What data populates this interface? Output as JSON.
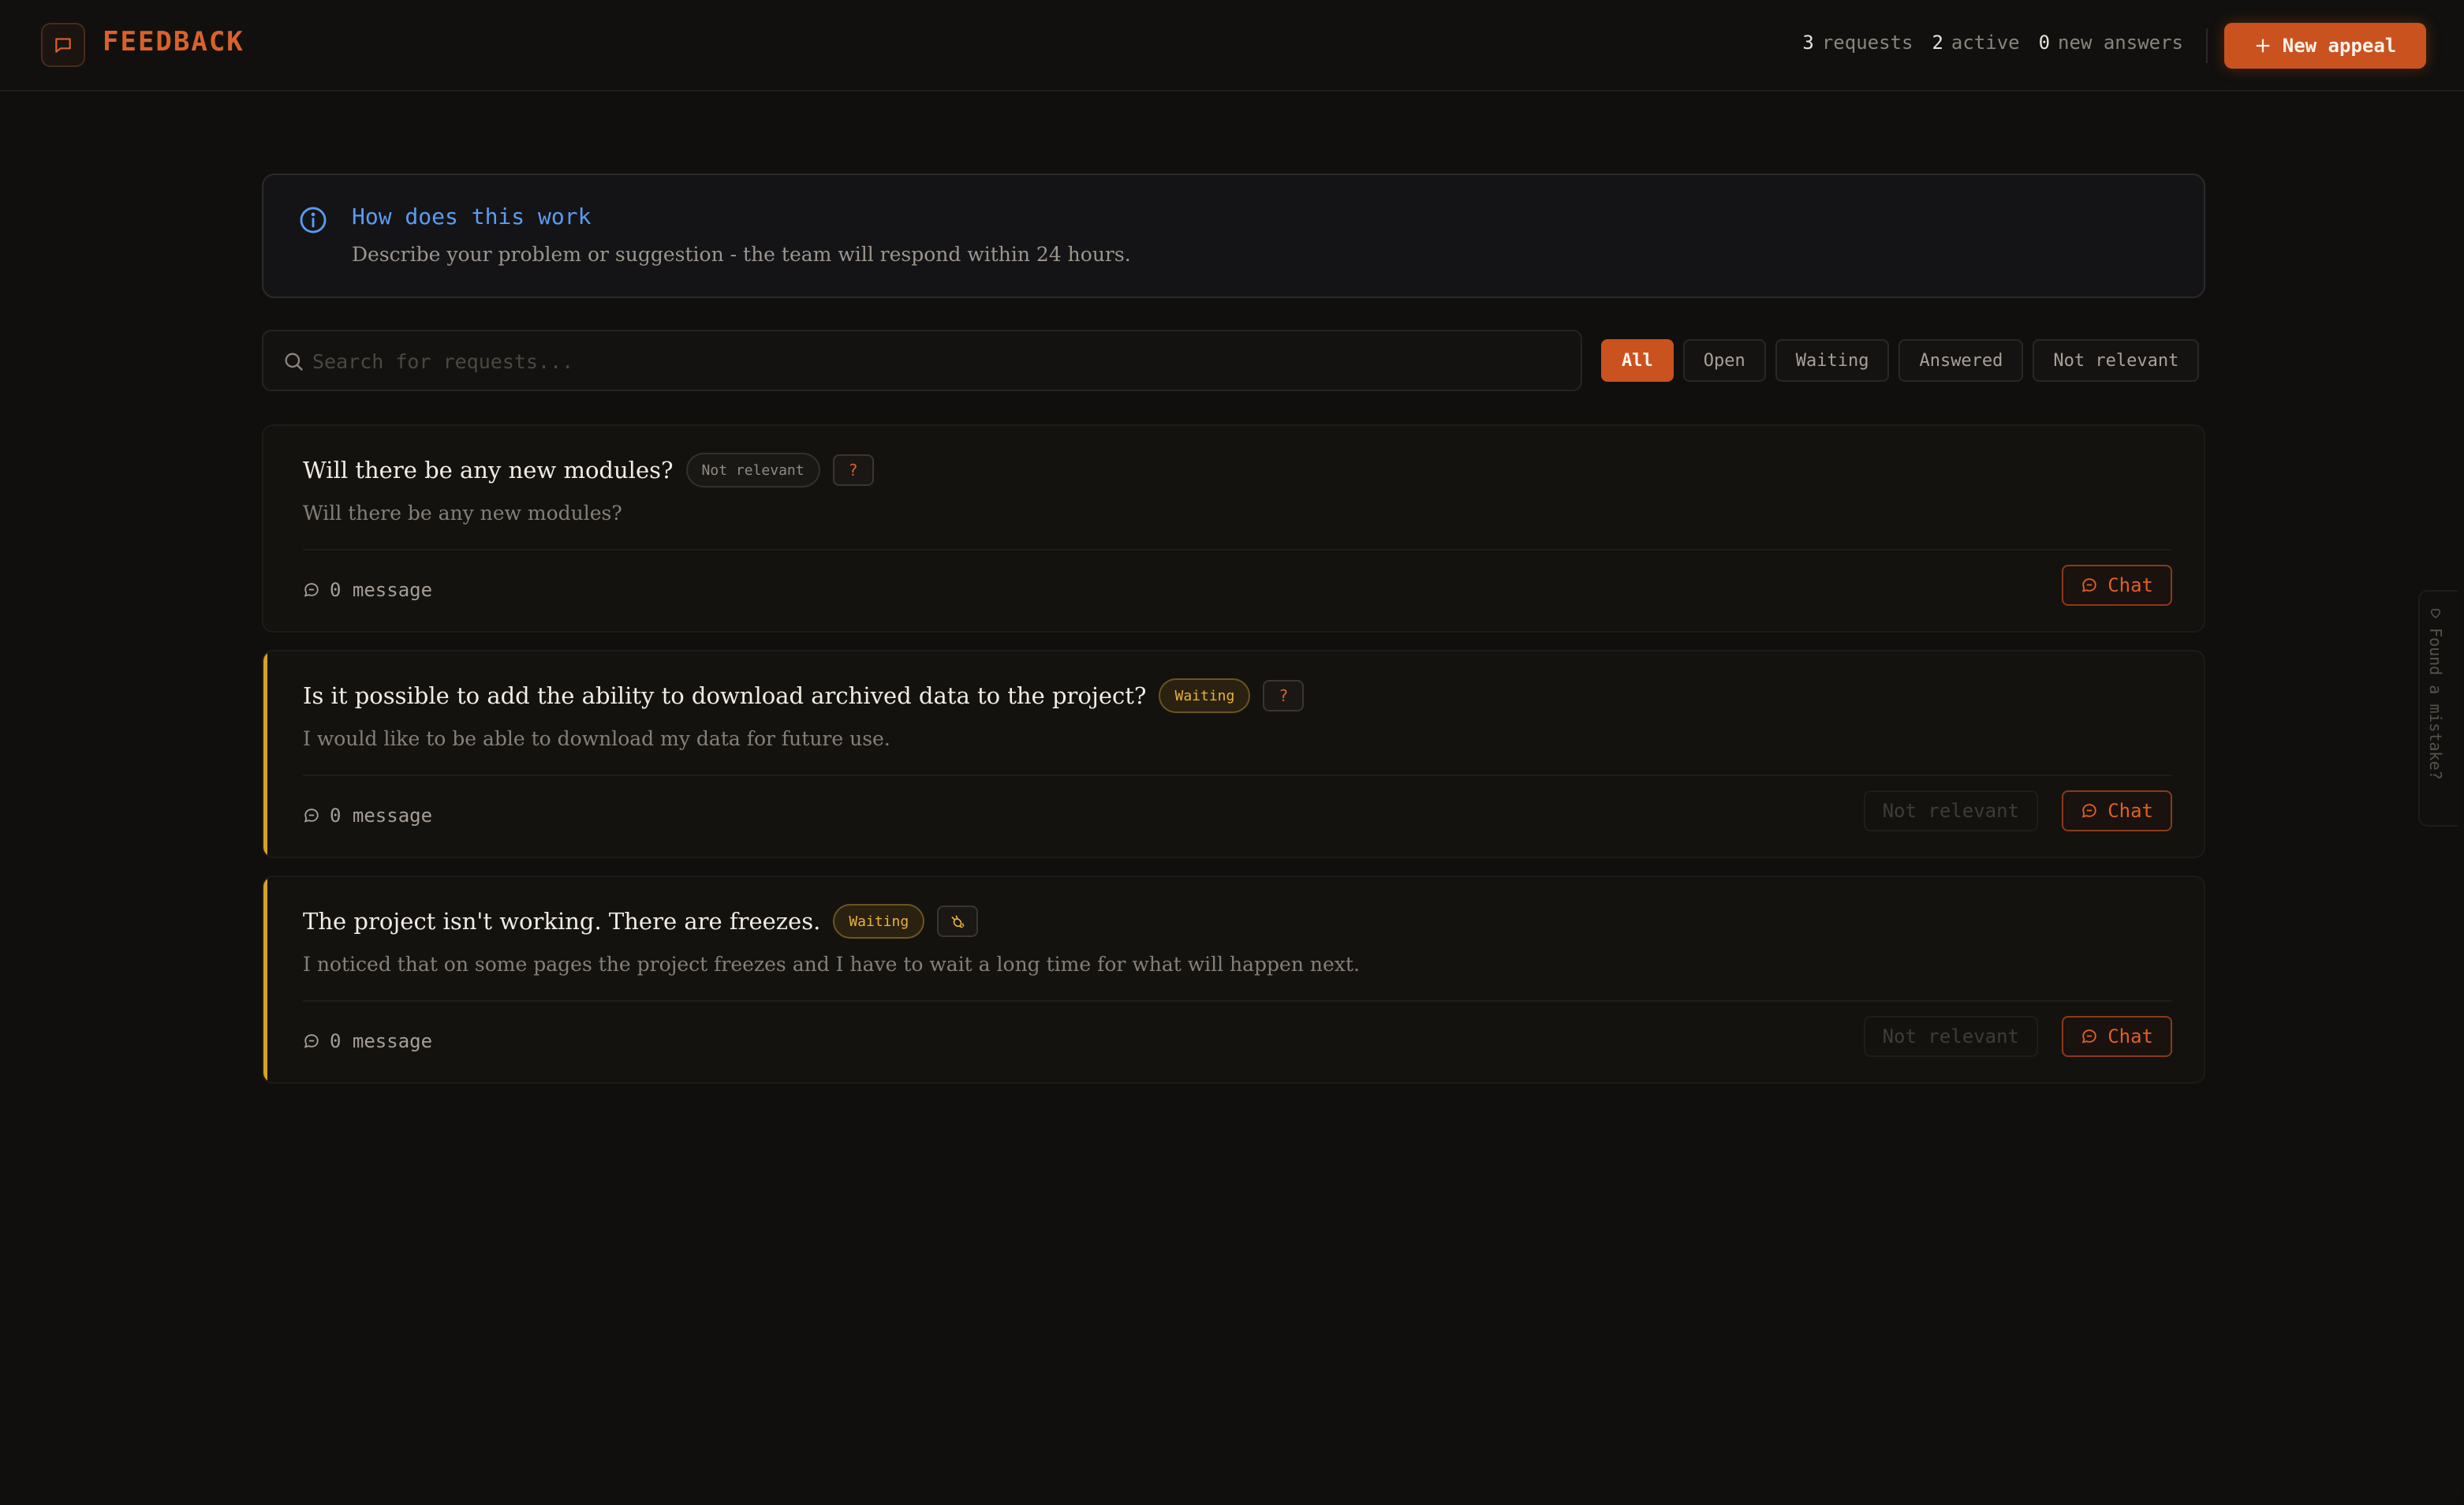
{
  "header": {
    "logo_text": "FEEDBACK",
    "stats": {
      "requests_count": "3",
      "requests_label": "requests",
      "active_count": "2",
      "active_label": "active",
      "answers_count": "0",
      "answers_label": "new answers"
    },
    "new_appeal_label": "New appeal"
  },
  "info": {
    "title": "How does this work",
    "text": "Describe your problem or suggestion - the team will respond within 24 hours."
  },
  "search": {
    "placeholder": "Search for requests..."
  },
  "filters": [
    "All",
    "Open",
    "Waiting",
    "Answered",
    "Not relevant"
  ],
  "active_filter": "All",
  "cards": [
    {
      "title": "Will there be any new modules?",
      "status": "Not relevant",
      "type_badge": "?",
      "description": "Will there be any new modules?",
      "messages": "0 message",
      "chat_label": "Chat"
    },
    {
      "title": "Is it possible to add the ability to download archived data to the project?",
      "status": "Waiting",
      "type_badge": "?",
      "description": "I would like to be able to download my data for future use.",
      "messages": "0 message",
      "not_relevant_label": "Not relevant",
      "chat_label": "Chat"
    },
    {
      "title": "The project isn't working. There are freezes.",
      "status": "Waiting",
      "type_badge_icon": "bug-icon",
      "description": "I noticed that on some pages the project freezes and I have to wait a long time for what will happen next.",
      "messages": "0 message",
      "not_relevant_label": "Not relevant",
      "chat_label": "Chat"
    }
  ],
  "side_tab": {
    "label": "Found a mistake?"
  },
  "colors": {
    "accent": "#c9521f",
    "info_blue": "#5a9cf0",
    "waiting_yellow": "#e7b33a"
  }
}
